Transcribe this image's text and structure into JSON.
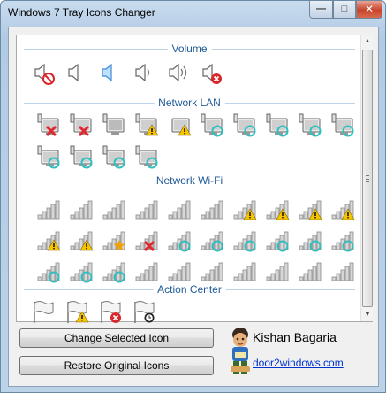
{
  "window": {
    "title": "Windows 7 Tray Icons Changer",
    "min": "—",
    "max": "□",
    "close": "✕"
  },
  "sections": {
    "volume": "Volume",
    "lan": "Network LAN",
    "wifi": "Network Wi-Fi",
    "action": "Action Center"
  },
  "icons": {
    "volume": [
      "speaker-muted-icon",
      "speaker-icon",
      "speaker-selected-icon",
      "speaker-low-icon",
      "speaker-high-icon",
      "speaker-error-icon"
    ],
    "lan": [
      "lan-error",
      "lan-error",
      "lan-off",
      "lan-warning",
      "lan-warning-plain",
      "lan-busy",
      "lan-busy",
      "lan-busy",
      "lan-busy",
      "lan-busy",
      "lan-busy",
      "lan-busy",
      "lan-busy",
      "lan-busy"
    ],
    "wifi_rows": [
      [
        "wifi",
        "wifi",
        "wifi",
        "wifi",
        "wifi",
        "wifi",
        "wifi-warning",
        "wifi-warning",
        "wifi-warning",
        "wifi-warning"
      ],
      [
        "wifi-warning",
        "wifi-warning",
        "wifi-star",
        "wifi-error",
        "wifi-busy",
        "wifi-busy",
        "wifi-busy",
        "wifi-busy",
        "wifi-busy",
        "wifi-busy"
      ],
      [
        "wifi-busy",
        "wifi-busy",
        "wifi-busy",
        "wifi",
        "wifi",
        "wifi",
        "wifi",
        "wifi",
        "wifi",
        "wifi"
      ]
    ],
    "action": [
      "flag",
      "flag-warning",
      "flag-error",
      "flag-busy"
    ]
  },
  "buttons": {
    "change": "Change Selected Icon",
    "restore": "Restore Original Icons"
  },
  "author": {
    "name": "Kishan Bagaria",
    "link": "door2windows.com"
  },
  "colors": {
    "section_label": "#1f5a96",
    "link": "#0033cc"
  }
}
